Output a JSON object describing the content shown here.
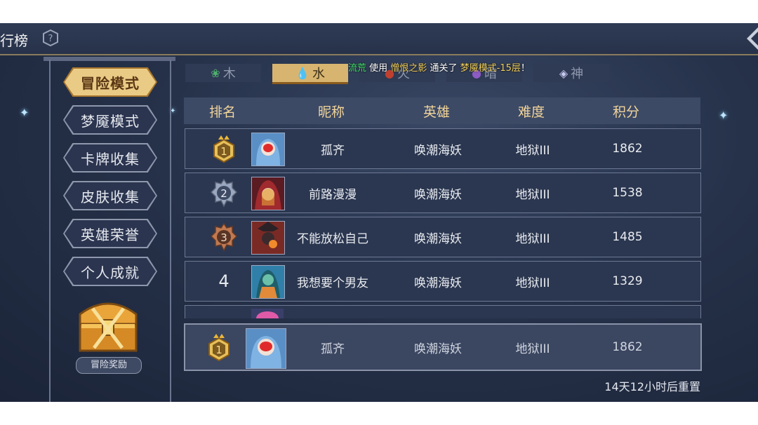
{
  "header": {
    "title": "行榜",
    "help_icon": "help-icon"
  },
  "menu": {
    "items": [
      {
        "label": "冒险模式",
        "active": true
      },
      {
        "label": "梦魇模式",
        "active": false
      },
      {
        "label": "卡牌收集",
        "active": false
      },
      {
        "label": "皮肤收集",
        "active": false
      },
      {
        "label": "英雄荣誉",
        "active": false
      },
      {
        "label": "个人成就",
        "active": false
      }
    ],
    "reward_label": "冒险奖励"
  },
  "tabs": [
    {
      "label": "木",
      "icon": "leaf-icon",
      "active": false
    },
    {
      "label": "水",
      "icon": "water-drop-icon",
      "active": true
    },
    {
      "label": "火",
      "icon": "fire-icon",
      "active": false
    },
    {
      "label": "暗",
      "icon": "dark-icon",
      "active": false
    },
    {
      "label": "神",
      "icon": "divine-icon",
      "active": false
    }
  ],
  "announcement": {
    "player": "流荒",
    "use": "使用",
    "hero": "憎恨之影",
    "cleared": "通关了",
    "level": "梦魇模式-15层",
    "end": "！"
  },
  "table": {
    "headers": {
      "rank": "排名",
      "name": "昵称",
      "hero": "英雄",
      "difficulty": "难度",
      "score": "积分"
    },
    "rows": [
      {
        "rank": "1",
        "name": "孤齐",
        "hero": "唤潮海妖",
        "difficulty": "地狱III",
        "score": "1862"
      },
      {
        "rank": "2",
        "name": "前路漫漫",
        "hero": "唤潮海妖",
        "difficulty": "地狱III",
        "score": "1538"
      },
      {
        "rank": "3",
        "name": "不能放松自己",
        "hero": "唤潮海妖",
        "difficulty": "地狱III",
        "score": "1485"
      },
      {
        "rank": "4",
        "name": "我想要个男友",
        "hero": "唤潮海妖",
        "difficulty": "地狱III",
        "score": "1329"
      }
    ],
    "self": {
      "rank": "1",
      "name": "孤齐",
      "hero": "唤潮海妖",
      "difficulty": "地狱III",
      "score": "1862"
    }
  },
  "reset_text": "14天12小时后重置",
  "colors": {
    "gold_accent": "#d7b570",
    "header_text": "#f2d59a",
    "bg": "#26324a"
  }
}
